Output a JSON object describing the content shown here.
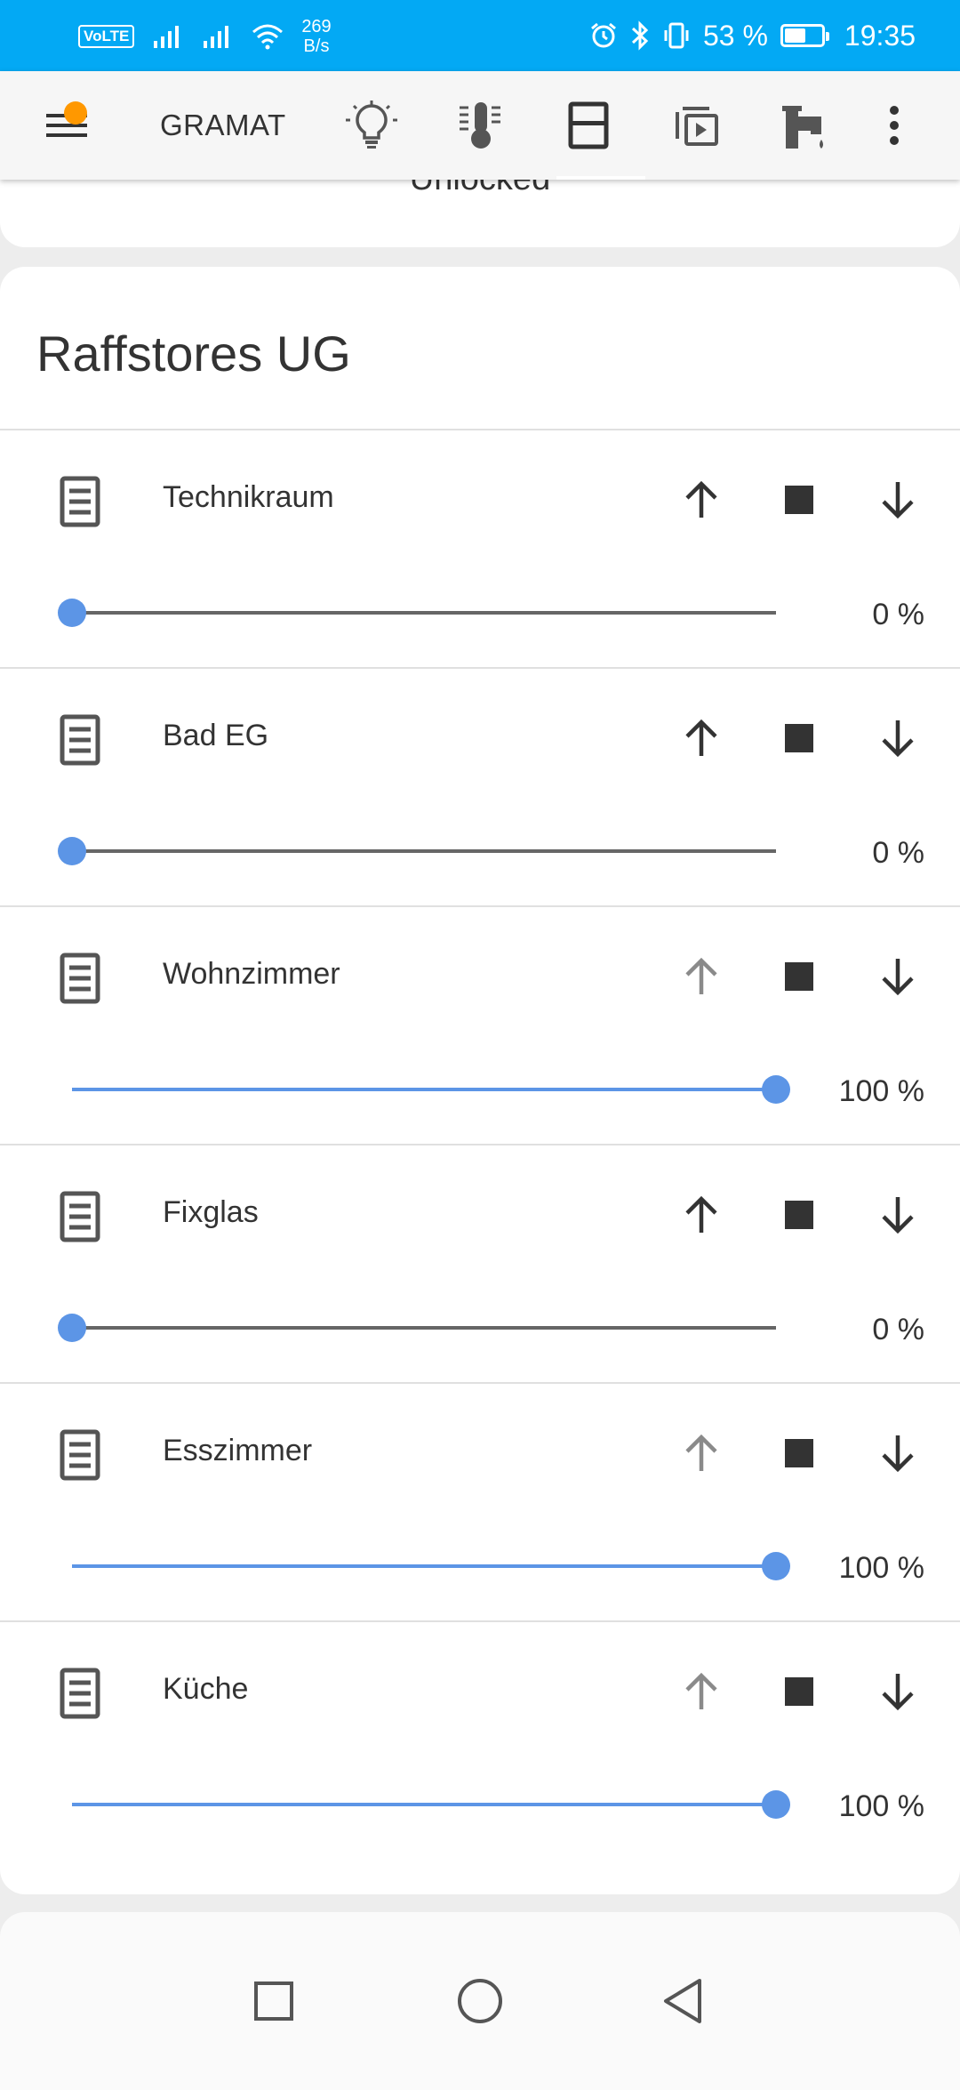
{
  "status_bar": {
    "volte": "VoLTE",
    "net_speed_value": "269",
    "net_speed_unit": "B/s",
    "battery": "53 %",
    "battery_level": 0.53,
    "time": "19:35"
  },
  "toolbar": {
    "title": "GRAMAT",
    "icons": [
      "menu-icon",
      "lightbulb-icon",
      "thermometer-icon",
      "blinds-icon",
      "media-icon",
      "faucet-icon",
      "more-vert-icon"
    ],
    "active_tab": "blinds",
    "badge_color": "#ff9800"
  },
  "top_card": {
    "text": "Unlocked"
  },
  "main_card": {
    "title": "Raffstores UG",
    "rows": [
      {
        "name": "Technikraum",
        "percent": "0 %",
        "position": 0,
        "up_enabled": true
      },
      {
        "name": "Bad EG",
        "percent": "0 %",
        "position": 0,
        "up_enabled": true
      },
      {
        "name": "Wohnzimmer",
        "percent": "100 %",
        "position": 100,
        "up_enabled": false
      },
      {
        "name": "Fixglas",
        "percent": "0 %",
        "position": 0,
        "up_enabled": true
      },
      {
        "name": "Esszimmer",
        "percent": "100 %",
        "position": 100,
        "up_enabled": false
      },
      {
        "name": "Küche",
        "percent": "100 %",
        "position": 100,
        "up_enabled": false
      }
    ]
  },
  "colors": {
    "status_bar": "#03a9f4",
    "accent": "#5c95e6"
  },
  "nav_bar": {
    "buttons": [
      "recents-icon",
      "home-icon",
      "back-icon"
    ]
  }
}
